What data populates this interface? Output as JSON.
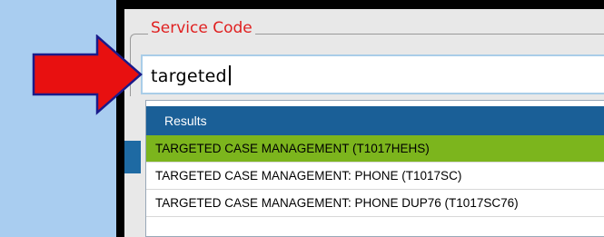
{
  "field": {
    "legend": "Service Code",
    "value": "targeted"
  },
  "dropdown": {
    "header": "Results",
    "items": [
      {
        "label": "TARGETED CASE MANAGEMENT (T1017HEHS)",
        "selected": true
      },
      {
        "label": "TARGETED CASE MANAGEMENT: PHONE (T1017SC)",
        "selected": false
      },
      {
        "label": "TARGETED CASE MANAGEMENT: PHONE DUP76 (T1017SC76)",
        "selected": false
      }
    ]
  },
  "colors": {
    "page_background": "#a9cdf0",
    "legend_text": "#e02020",
    "results_header": "#1a5f97",
    "selected_item": "#7cb51d",
    "arrow_fill": "#e81010",
    "arrow_stroke": "#1a1a8a"
  },
  "icons": {
    "annotation_arrow": "red-arrow-icon"
  }
}
